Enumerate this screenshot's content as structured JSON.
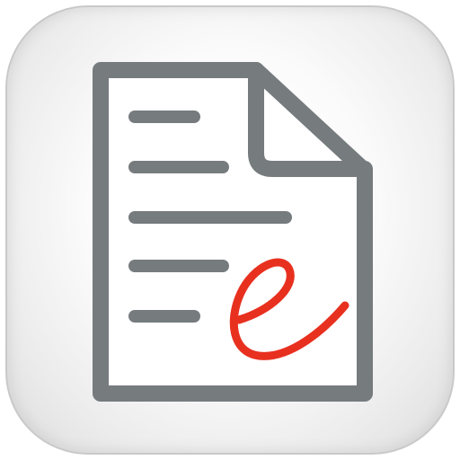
{
  "icon": {
    "name": "document-e-icon",
    "description_colors": {
      "document_stroke": "#767b7e",
      "document_fill": "#ffffff",
      "signature_color": "#e8301f",
      "tile_edge": "#c9c9c9"
    }
  }
}
